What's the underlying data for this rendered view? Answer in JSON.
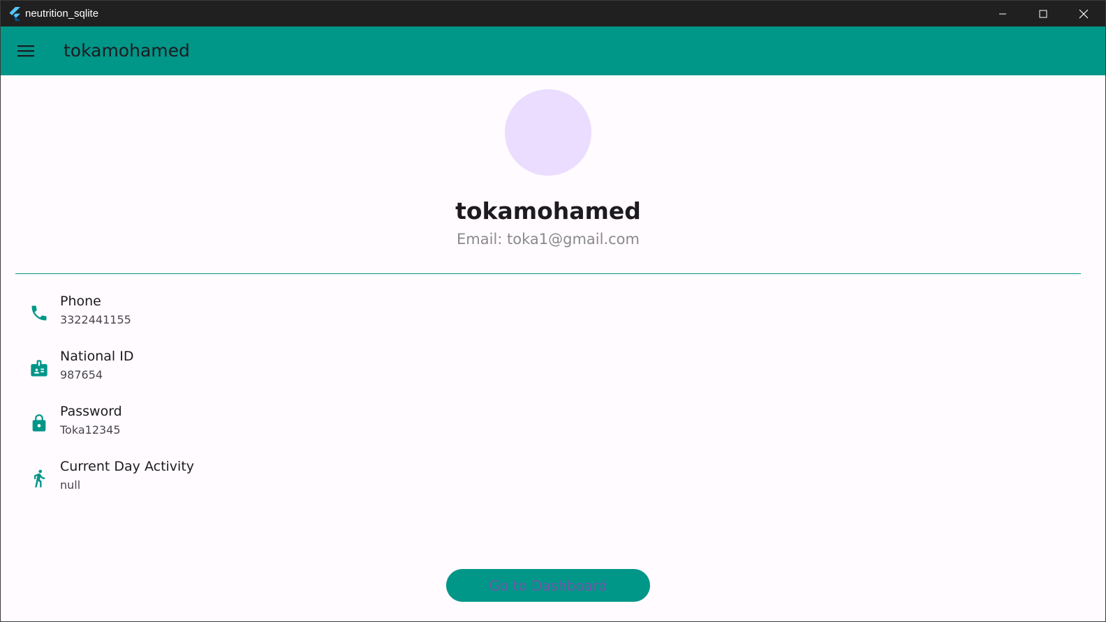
{
  "window": {
    "title": "neutrition_sqlite",
    "controls": [
      "minimize-icon",
      "maximize-icon",
      "close-icon"
    ]
  },
  "appbar": {
    "menu_icon": "menu-icon",
    "title": "tokamohamed"
  },
  "profile": {
    "name": "tokamohamed",
    "email": "Email: toka1@gmail.com"
  },
  "info": [
    {
      "icon": "phone-icon",
      "label": "Phone",
      "value": "3322441155"
    },
    {
      "icon": "badge-icon",
      "label": "National ID",
      "value": "987654"
    },
    {
      "icon": "lock-icon",
      "label": "Password",
      "value": "Toka12345"
    },
    {
      "icon": "run-icon",
      "label": "Current Day Activity",
      "value": "null"
    }
  ],
  "actions": {
    "dashboard_label": "Go to Dashboard"
  },
  "colors": {
    "primary": "#009688",
    "avatar": "#eaddff",
    "background": "#fffbfe",
    "titlebar": "#202020",
    "button_text": "#6e58a8"
  }
}
